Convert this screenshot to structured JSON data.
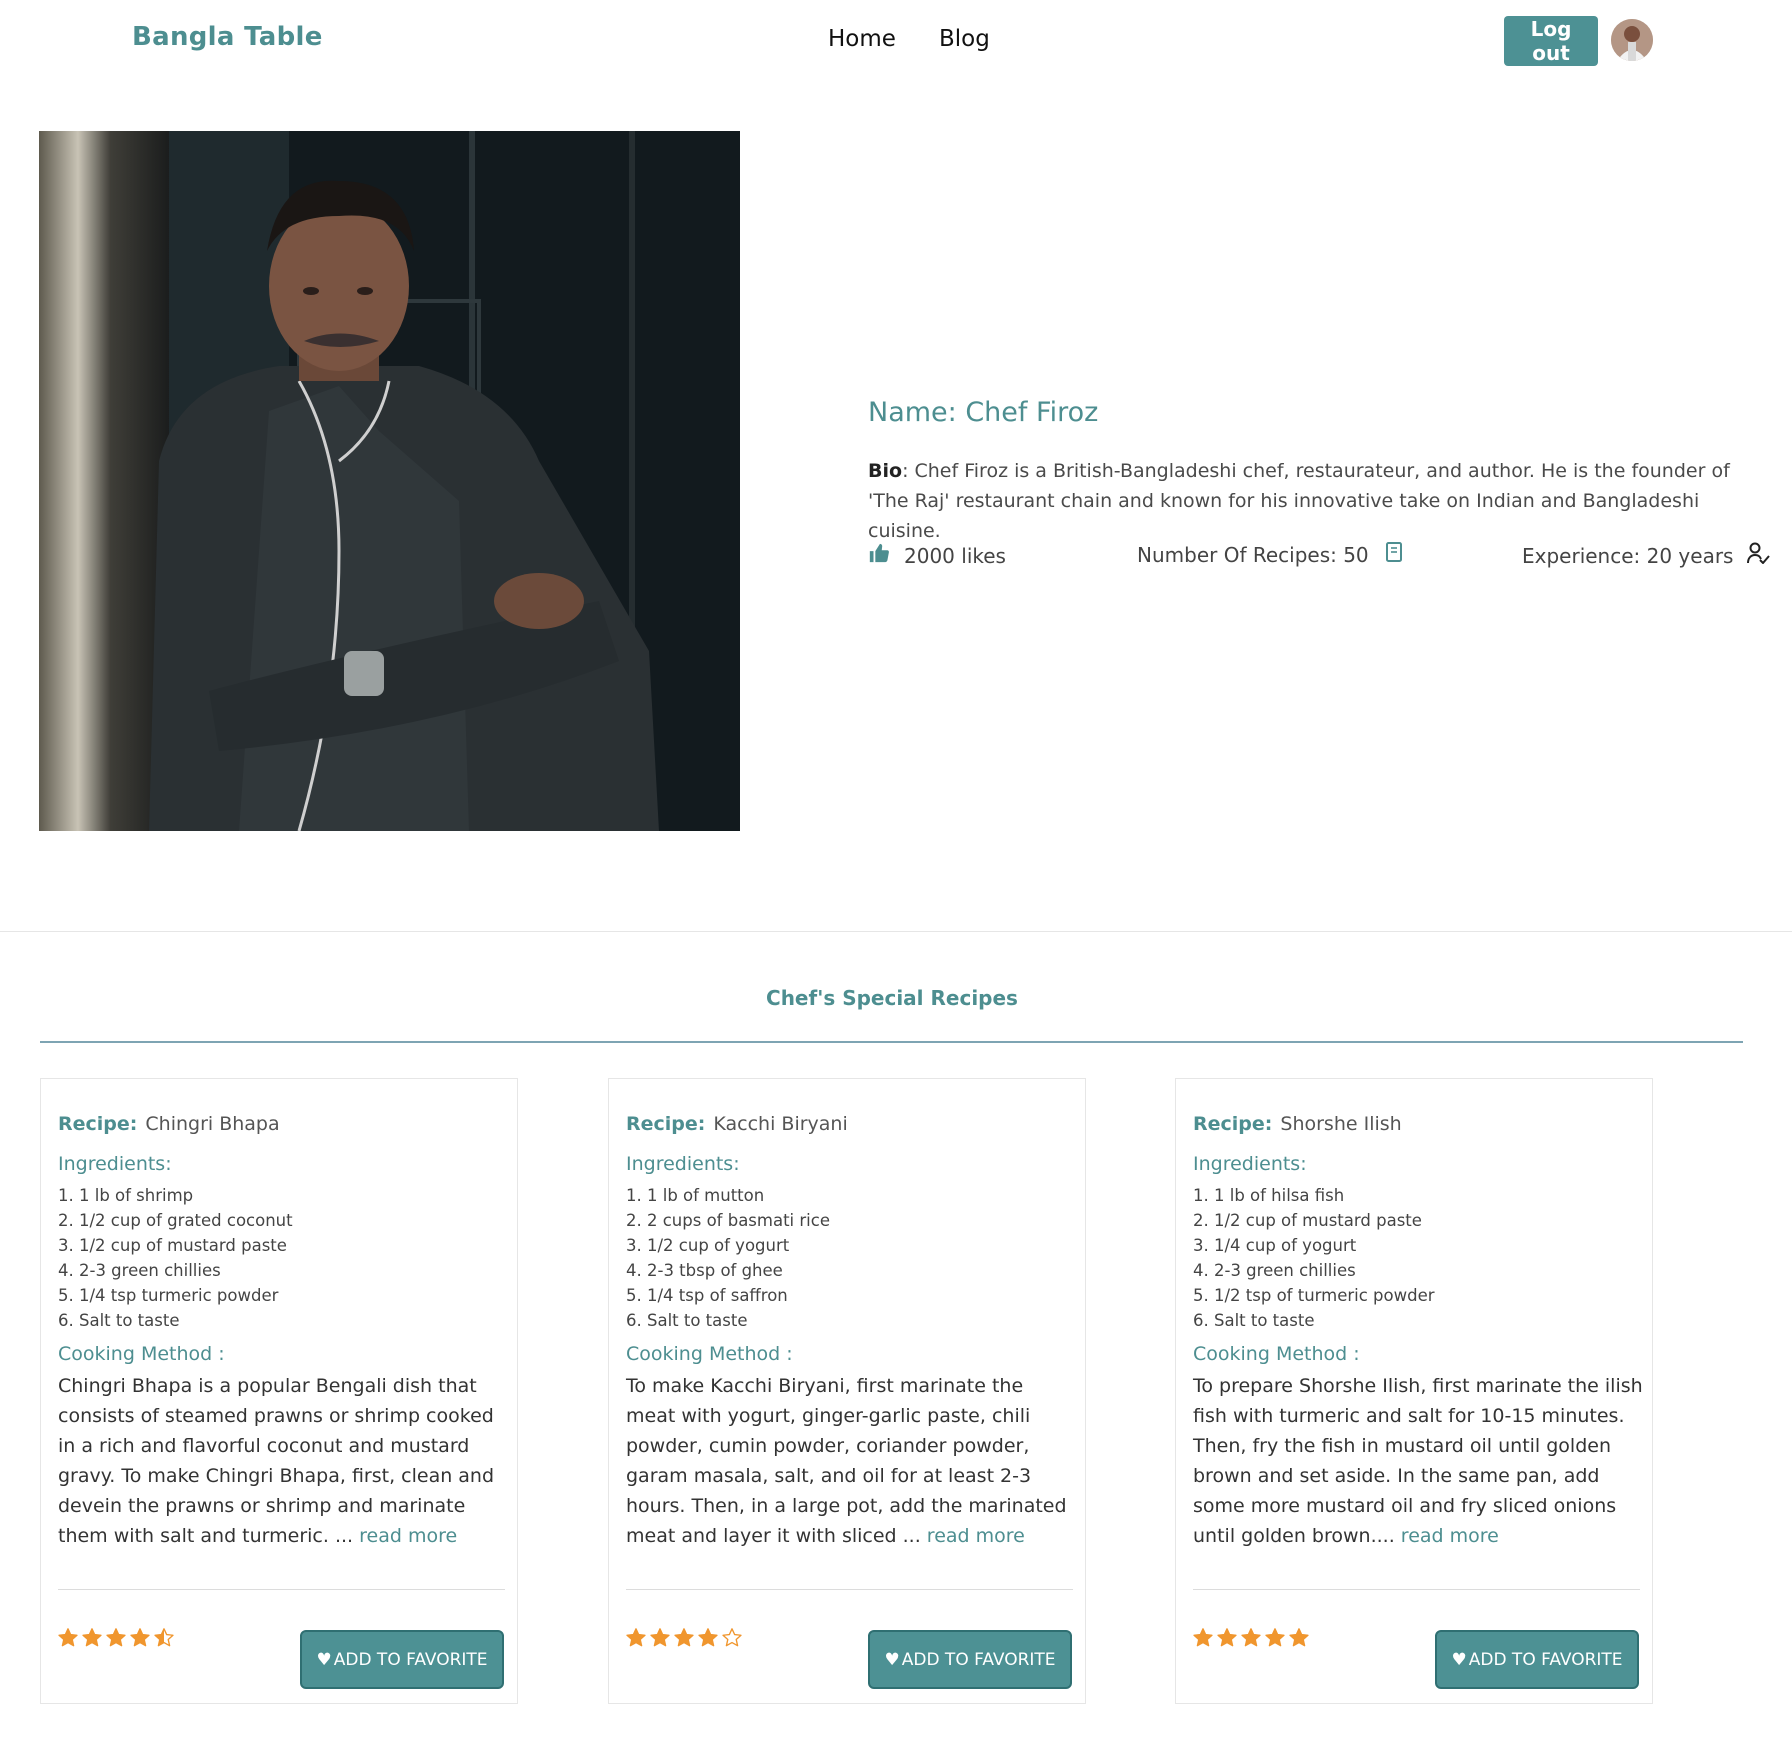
{
  "header": {
    "brand": "Bangla Table",
    "nav": [
      "Home",
      "Blog"
    ],
    "logout_label": "Log out"
  },
  "chef": {
    "name": "Name: Chef Firoz",
    "bio_label": "Bio",
    "bio_text": ": Chef Firoz is a British-Bangladeshi chef, restaurateur, and author. He is the founder of 'The Raj' restaurant chain and known for his innovative take on Indian and Bangladeshi cuisine.",
    "likes": "2000 likes",
    "recipes": "Number Of Recipes: 50",
    "experience": "Experience: 20 years"
  },
  "section": {
    "title": "Chef's Special Recipes"
  },
  "labels": {
    "recipe": "Recipe:",
    "ingredients": "Ingredients:",
    "cooking_method": "Cooking Method :",
    "read_more": "read more",
    "add_favorite": "ADD TO FAVORITE"
  },
  "recipes": [
    {
      "name": "Chingri Bhapa",
      "ingredients": [
        "1. 1 lb of shrimp",
        "2. 1/2 cup of grated coconut",
        "3. 1/2 cup of mustard paste",
        "4. 2-3 green chillies",
        "5. 1/4 tsp turmeric powder",
        "6. Salt to taste"
      ],
      "method": "Chingri Bhapa is a popular Bengali dish that consists of steamed prawns or shrimp cooked in a rich and flavorful coconut and mustard gravy. To make Chingri Bhapa, first, clean and devein the prawns or shrimp and marinate them with salt and turmeric. ... ",
      "rating": 4.5
    },
    {
      "name": "Kacchi Biryani",
      "ingredients": [
        "1. 1 lb of mutton",
        "2. 2 cups of basmati rice",
        "3. 1/2 cup of yogurt",
        "4. 2-3 tbsp of ghee",
        "5. 1/4 tsp of saffron",
        "6. Salt to taste"
      ],
      "method": "To make Kacchi Biryani, first marinate the meat with yogurt, ginger-garlic paste, chili powder, cumin powder, coriander powder, garam masala, salt, and oil for at least 2-3 hours. Then, in a large pot, add the marinated meat and layer it with sliced ... ",
      "rating": 4
    },
    {
      "name": "Shorshe Ilish",
      "ingredients": [
        "1. 1 lb of hilsa fish",
        "2. 1/2 cup of mustard paste",
        "3. 1/4 cup of yogurt",
        "4. 2-3 green chillies",
        "5. 1/2 tsp of turmeric powder",
        "6. Salt to taste"
      ],
      "method": "To prepare Shorshe Ilish, first marinate the ilish fish with turmeric and salt for 10-15 minutes. Then, fry the fish in mustard oil until golden brown and set aside. In the same pan, add some more mustard oil and fry sliced onions until golden brown.... ",
      "rating": 5
    }
  ],
  "colors": {
    "accent": "#4d8e90",
    "button": "#4d9194",
    "star": "#f0962e"
  }
}
